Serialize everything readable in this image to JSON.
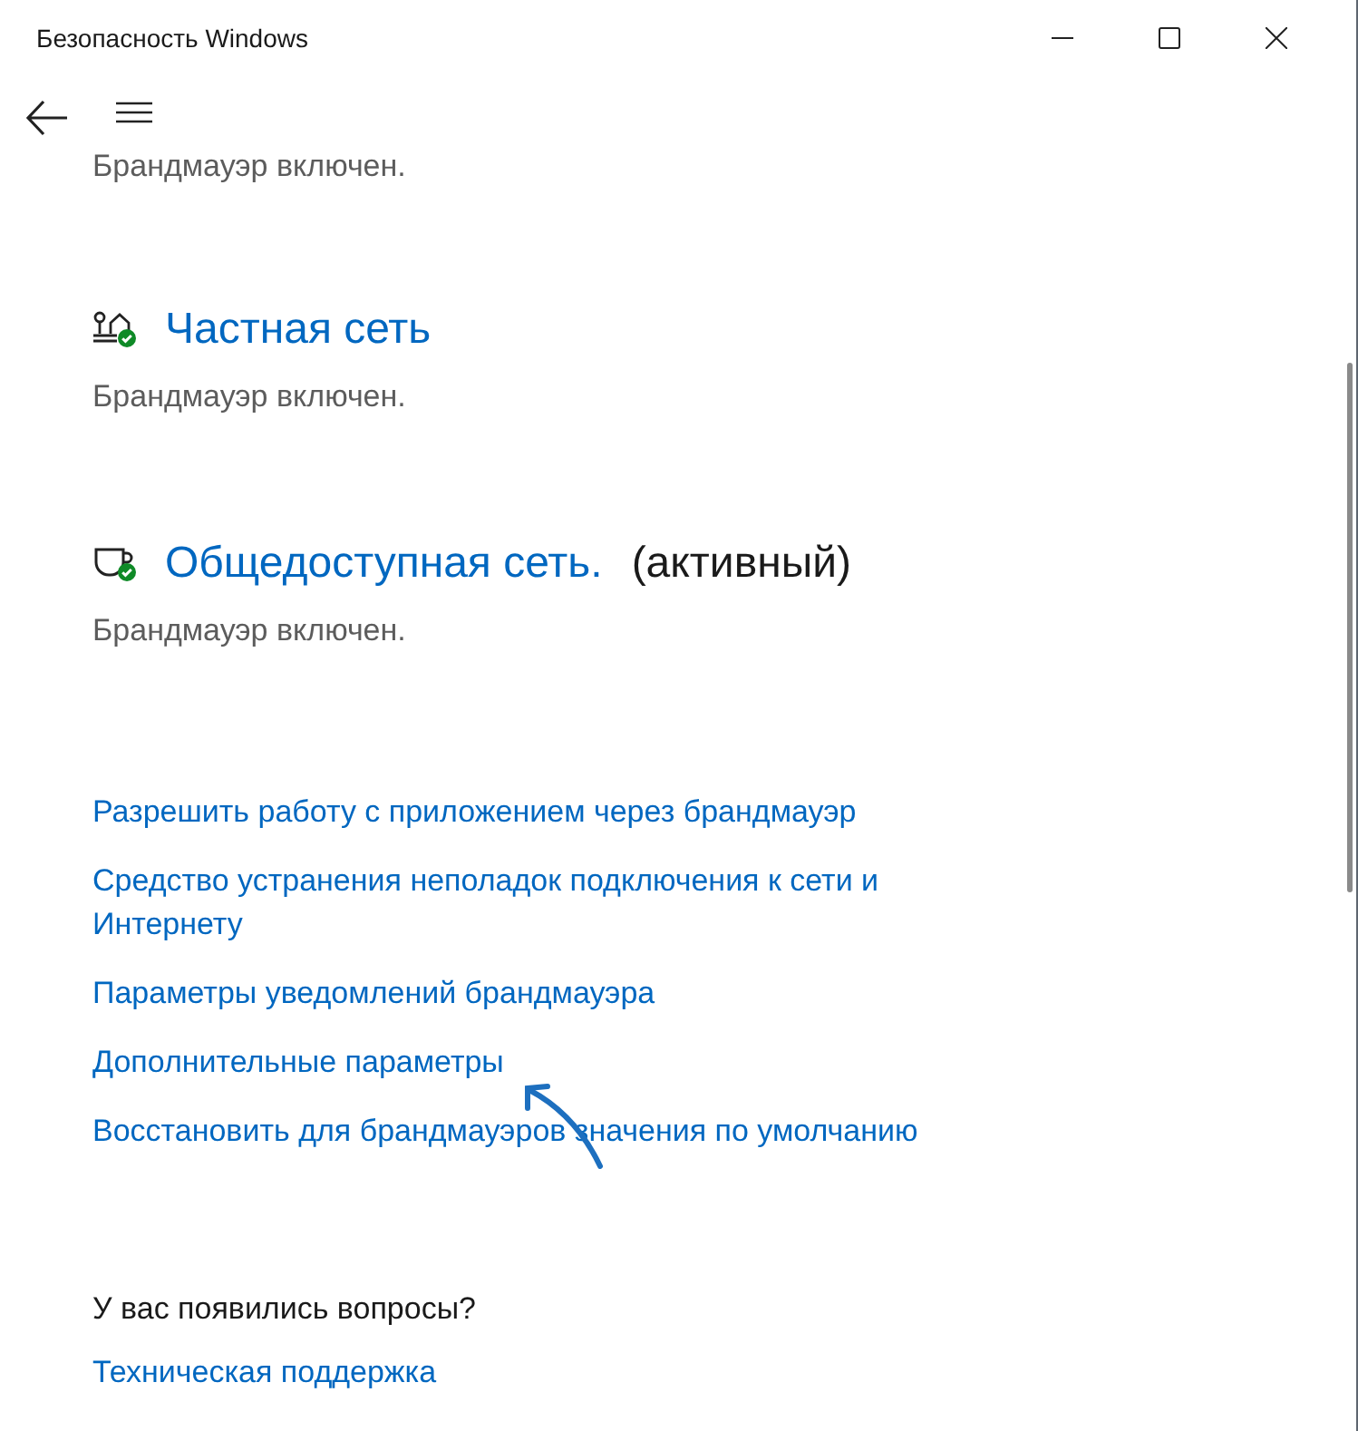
{
  "window": {
    "title": "Безопасность Windows"
  },
  "networks": [
    {
      "kind": "partial",
      "status": "Брандмауэр включен."
    },
    {
      "kind": "private",
      "name": "Частная сеть",
      "status": "Брандмауэр включен."
    },
    {
      "kind": "public",
      "name": "Общедоступная сеть.",
      "active_label": "(активный)",
      "status": "Брандмауэр включен."
    }
  ],
  "links": [
    "Разрешить работу с приложением через брандмауэр",
    "Средство устранения неполадок подключения к сети и Интернету",
    "Параметры уведомлений брандмауэра",
    "Дополнительные параметры",
    "Восстановить для брандмауэров значения по умолчанию"
  ],
  "help": {
    "heading": "У вас появились вопросы?",
    "link": "Техническая поддержка"
  }
}
